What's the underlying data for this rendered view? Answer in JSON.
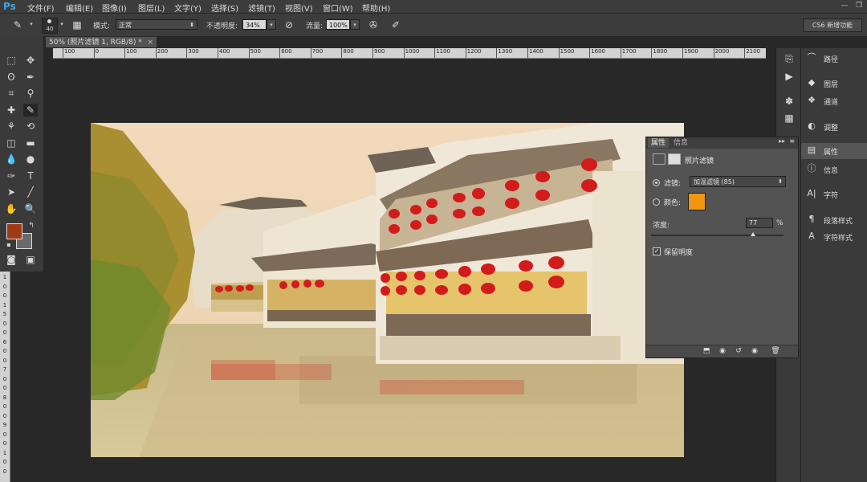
{
  "app": {
    "logo": "Ps",
    "menu": [
      "文件(F)",
      "编辑(E)",
      "图像(I)",
      "图层(L)",
      "文字(Y)",
      "选择(S)",
      "滤镜(T)",
      "视图(V)",
      "窗口(W)",
      "帮助(H)"
    ]
  },
  "options_bar": {
    "brush_size": "40",
    "mode_label": "模式:",
    "mode_value": "正常",
    "opacity_label": "不透明度:",
    "opacity_value": "34%",
    "flow_label": "流量:",
    "flow_value": "100%",
    "workspace_button": "CS6 新增功能"
  },
  "document": {
    "tab_title": "50% (照片滤镜 1, RGB/8) *",
    "ruler_ticks": [
      "100",
      "0",
      "100",
      "200",
      "300",
      "400",
      "500",
      "600",
      "700",
      "800",
      "900",
      "1000",
      "1100",
      "1200",
      "1300",
      "1400",
      "1500",
      "1600",
      "1700",
      "1800",
      "1900",
      "2000",
      "2100"
    ],
    "vruler_ticks": [
      "1",
      "0",
      "0",
      "1",
      "5",
      "0",
      "0",
      "6",
      "0",
      "0",
      "7",
      "0",
      "0",
      "8",
      "0",
      "0",
      "9",
      "0",
      "0",
      "1",
      "0",
      "0"
    ]
  },
  "properties_panel": {
    "tabs": [
      "属性",
      "信息"
    ],
    "title": "照片滤镜",
    "filter_label": "滤镜:",
    "filter_value": "加温滤镜 (85)",
    "color_label": "颜色:",
    "color_value": "#f1960d",
    "density_label": "浓度:",
    "density_value": "77",
    "density_unit": "%",
    "density_level": 0.77,
    "preserve_luminosity_label": "保留明度",
    "preserve_luminosity_checked": true
  },
  "right_dock": {
    "items": [
      {
        "icon": "path-icon",
        "label": "路径"
      },
      {
        "icon": "layers-icon",
        "label": "图层"
      },
      {
        "icon": "channels-icon",
        "label": "通道"
      },
      {
        "icon": "adjustments-icon",
        "label": "调整"
      },
      {
        "icon": "properties-icon",
        "label": "属性"
      },
      {
        "icon": "info-icon",
        "label": "信息"
      },
      {
        "icon": "character-icon",
        "label": "字符"
      },
      {
        "icon": "paragraph-style-icon",
        "label": "段落样式"
      },
      {
        "icon": "character-style-icon",
        "label": "字符样式"
      }
    ]
  }
}
